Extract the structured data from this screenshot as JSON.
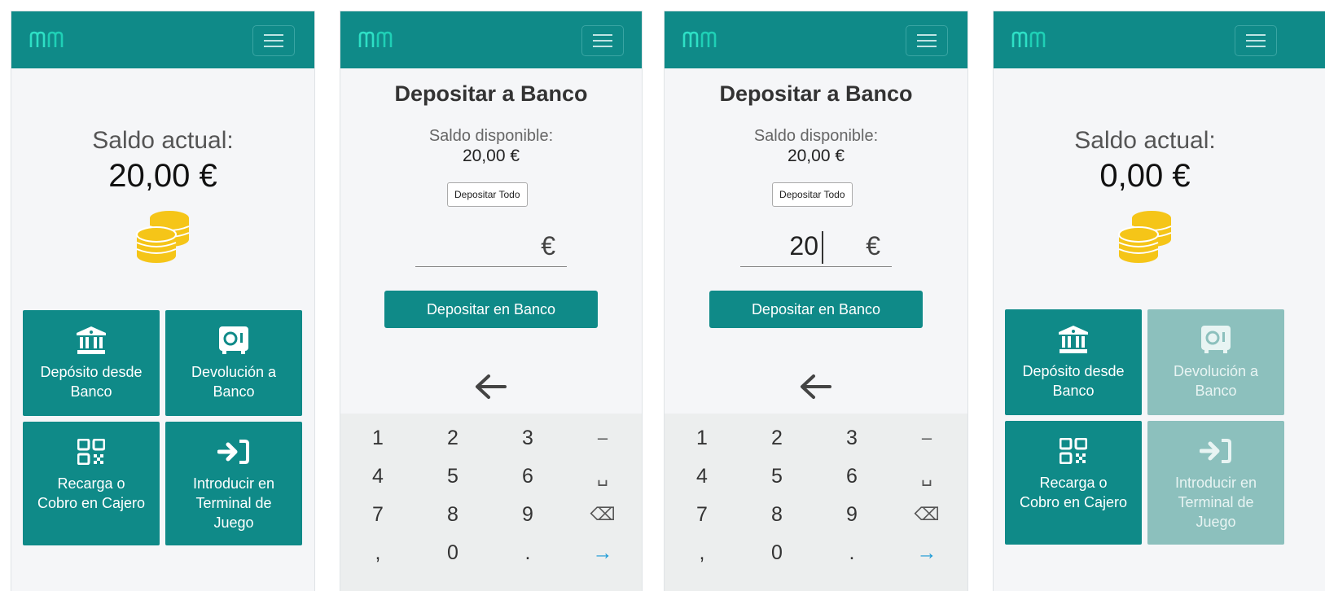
{
  "logo_text": "mm",
  "brand_colors": {
    "primary": "#0f8a88",
    "disabled": "#8cc0bd",
    "coins": "#f5c518"
  },
  "screen1": {
    "balance_label": "Saldo actual:",
    "balance_value": "20,00 €",
    "tiles": [
      {
        "label": "Depósito desde\nBanco",
        "icon": "bank-icon"
      },
      {
        "label": "Devolución a\nBanco",
        "icon": "safe-icon"
      },
      {
        "label": "Recarga o\nCobro en Cajero",
        "icon": "qr-code-icon"
      },
      {
        "label": "Introducir en\nTerminal de\nJuego",
        "icon": "sign-in-icon"
      }
    ]
  },
  "screen2": {
    "title": "Depositar a Banco",
    "available_label": "Saldo disponible:",
    "available_value": "20,00 €",
    "deposit_all_label": "Depositar Todo",
    "amount_value": "",
    "currency_symbol": "€",
    "submit_label": "Depositar en Banco"
  },
  "screen3": {
    "title": "Depositar a Banco",
    "available_label": "Saldo disponible:",
    "available_value": "20,00 €",
    "deposit_all_label": "Depositar Todo",
    "amount_value": "20",
    "currency_symbol": "€",
    "submit_label": "Depositar en Banco"
  },
  "screen4": {
    "balance_label": "Saldo actual:",
    "balance_value": "0,00 €",
    "tiles": [
      {
        "label": "Depósito desde\nBanco",
        "icon": "bank-icon",
        "enabled": true
      },
      {
        "label": "Devolución a\nBanco",
        "icon": "safe-icon",
        "enabled": false
      },
      {
        "label": "Recarga o\nCobro en Cajero",
        "icon": "qr-code-icon",
        "enabled": true
      },
      {
        "label": "Introducir en\nTerminal de\nJuego",
        "icon": "sign-in-icon",
        "enabled": false
      }
    ]
  },
  "keypad": {
    "keys": [
      "1",
      "2",
      "3",
      "–",
      "4",
      "5",
      "6",
      "␣",
      "7",
      "8",
      "9",
      "⌫",
      ",",
      "0",
      ".",
      "→"
    ]
  }
}
